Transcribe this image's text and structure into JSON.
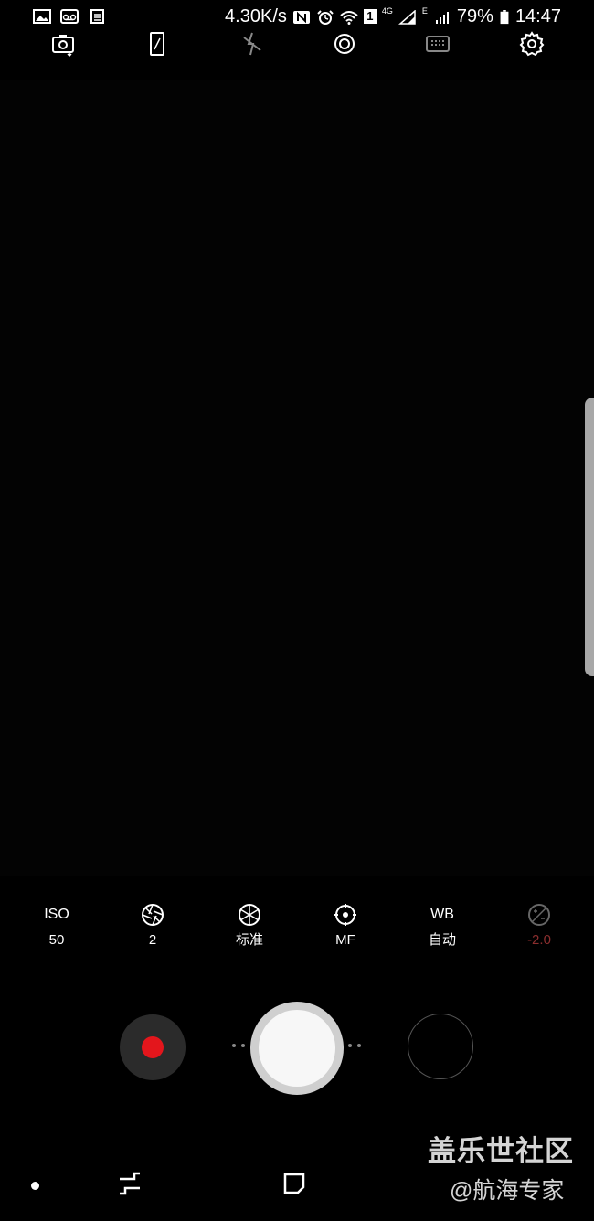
{
  "status_bar": {
    "speed": "4.30K/s",
    "signal_4g": "4G",
    "signal_e": "E",
    "sim_badge": "1",
    "battery": "79%",
    "time": "14:47",
    "left_icons": [
      "image-icon",
      "voicemail-icon",
      "document-icon"
    ],
    "right_icons": [
      "nfc-icon",
      "alarm-icon",
      "wifi-icon",
      "signal-icon",
      "battery-icon"
    ]
  },
  "top_toolbar": {
    "icons": [
      "switch-camera-icon",
      "aspect-ratio-icon",
      "flash-off-icon",
      "hdr-icon",
      "metering-grid-icon",
      "settings-gear-icon"
    ]
  },
  "pro_controls": [
    {
      "name": "iso",
      "label": "ISO",
      "value": "50"
    },
    {
      "name": "aperture",
      "icon": "aperture-icon",
      "value": "2"
    },
    {
      "name": "shutter-speed",
      "icon": "shutter-icon",
      "value": "标准"
    },
    {
      "name": "focus",
      "icon": "focus-icon",
      "value": "MF"
    },
    {
      "name": "white-balance",
      "label": "WB",
      "value": "自动"
    },
    {
      "name": "exposure",
      "icon": "exposure-icon",
      "value": "-2.0"
    }
  ],
  "colors": {
    "record": "#e3161c",
    "background": "#000000",
    "exposure_value": "#8b2e2e"
  },
  "watermark": {
    "title": "盖乐世社区",
    "subtitle": "@航海专家"
  }
}
